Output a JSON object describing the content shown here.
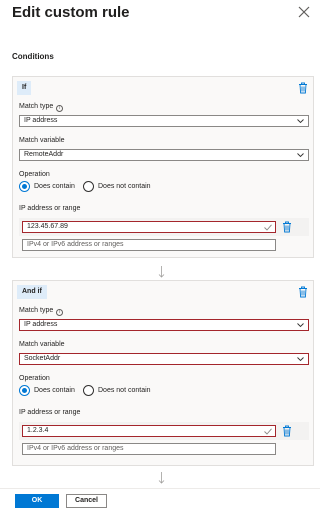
{
  "panel": {
    "title": "Edit custom rule",
    "section": "Conditions",
    "ok_label": "OK",
    "cancel_label": "Cancel"
  },
  "conditions": [
    {
      "chip": "If",
      "match_type_label": "Match type",
      "match_type_value": "IP address",
      "match_variable_label": "Match variable",
      "match_variable_value": "RemoteAddr",
      "operation_label": "Operation",
      "op_contains": "Does contain",
      "op_not_contains": "Does not contain",
      "operation_selected": "Does contain",
      "ip_label": "IP address or range",
      "ip_value": "123.45.67.89",
      "ip_placeholder": "IPv4 or IPv6 address or ranges"
    },
    {
      "chip": "And if",
      "match_type_label": "Match type",
      "match_type_value": "IP address",
      "match_variable_label": "Match variable",
      "match_variable_value": "SocketAddr",
      "operation_label": "Operation",
      "op_contains": "Does contain",
      "op_not_contains": "Does not contain",
      "operation_selected": "Does contain",
      "ip_label": "IP address or range",
      "ip_value": "1.2.3.4",
      "ip_placeholder": "IPv4 or IPv6 address or ranges"
    }
  ],
  "icons": {
    "close": "close-icon",
    "delete": "trash-icon",
    "info": "info-icon",
    "dropdown": "chevron-down-icon",
    "valid": "checkmark-icon",
    "flow": "down-arrow-icon"
  },
  "colors": {
    "accent": "#0078d4",
    "chip_bg": "#deecf9",
    "card_bg": "#faf9f8",
    "focus_border": "#a4262c"
  }
}
